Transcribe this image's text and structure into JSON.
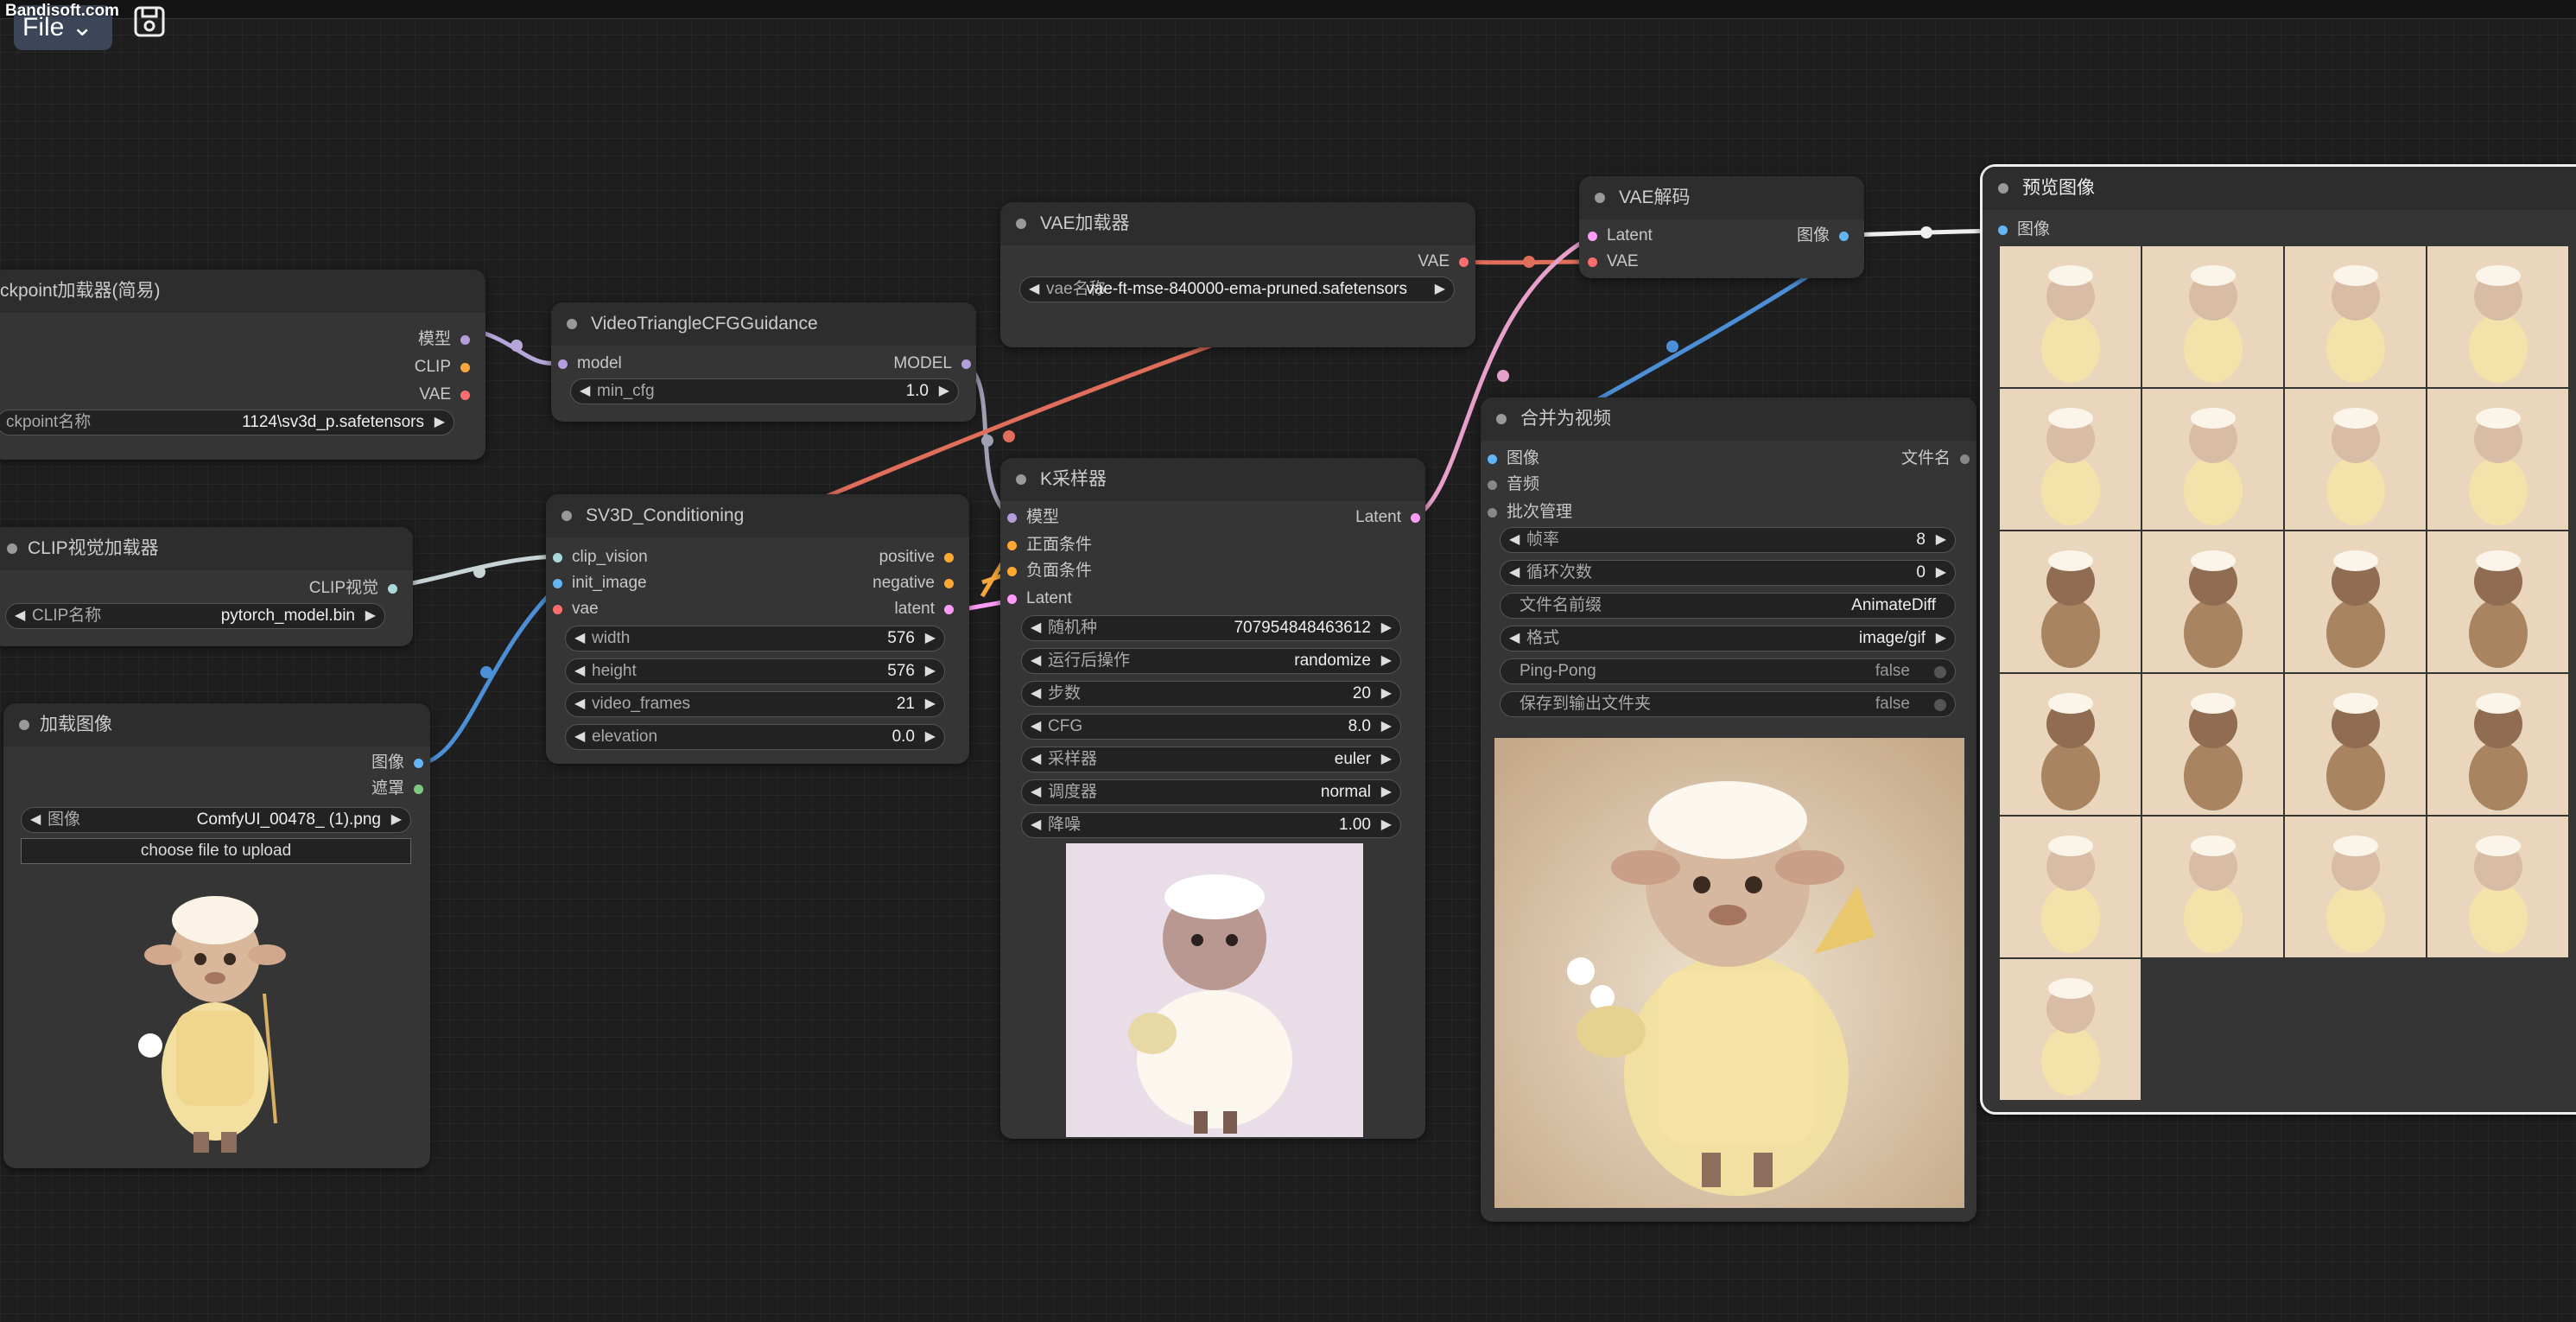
{
  "watermark": "Bandisoft.com",
  "menu": {
    "file": "File"
  },
  "nodes": {
    "checkpoint": {
      "title": "ckpoint加载器(简易)",
      "out_model": "模型",
      "out_clip": "CLIP",
      "out_vae": "VAE",
      "w_label": "ckpoint名称",
      "w_value": "1124\\sv3d_p.safetensors"
    },
    "vtcfg": {
      "title": "VideoTriangleCFGGuidance",
      "in_model": "model",
      "out_model": "MODEL",
      "w_label": "min_cfg",
      "w_value": "1.0"
    },
    "clipvision": {
      "title": "CLIP视觉加载器",
      "out": "CLIP视觉",
      "w_label": "CLIP名称",
      "w_value": "pytorch_model.bin"
    },
    "loadimage": {
      "title": "加载图像",
      "out_image": "图像",
      "out_mask": "遮罩",
      "w_label": "图像",
      "w_value": "ComfyUI_00478_ (1).png",
      "upload": "choose file to upload"
    },
    "sv3d": {
      "title": "SV3D_Conditioning",
      "in_clip": "clip_vision",
      "in_init": "init_image",
      "in_vae": "vae",
      "out_pos": "positive",
      "out_neg": "negative",
      "out_lat": "latent",
      "widgets": [
        {
          "label": "width",
          "value": "576"
        },
        {
          "label": "height",
          "value": "576"
        },
        {
          "label": "video_frames",
          "value": "21"
        },
        {
          "label": "elevation",
          "value": "0.0"
        }
      ]
    },
    "vaeloader": {
      "title": "VAE加载器",
      "out": "VAE",
      "w_label": "vae名称",
      "w_value": "vae-ft-mse-840000-ema-pruned.safetensors"
    },
    "ksampler": {
      "title": "K采样器",
      "in_model": "模型",
      "in_pos": "正面条件",
      "in_neg": "负面条件",
      "in_lat": "Latent",
      "out_lat": "Latent",
      "widgets": [
        {
          "label": "随机种",
          "value": "707954848463612"
        },
        {
          "label": "运行后操作",
          "value": "randomize"
        },
        {
          "label": "步数",
          "value": "20"
        },
        {
          "label": "CFG",
          "value": "8.0"
        },
        {
          "label": "采样器",
          "value": "euler"
        },
        {
          "label": "调度器",
          "value": "normal"
        },
        {
          "label": "降噪",
          "value": "1.00"
        }
      ]
    },
    "vaedecode": {
      "title": "VAE解码",
      "in_lat": "Latent",
      "in_vae": "VAE",
      "out_img": "图像"
    },
    "combine": {
      "title": "合并为视频",
      "in_img": "图像",
      "in_audio": "音频",
      "in_batch": "批次管理",
      "out_fn": "文件名",
      "widgets": [
        {
          "label": "帧率",
          "value": "8"
        },
        {
          "label": "循环次数",
          "value": "0"
        },
        {
          "label": "文件名前缀",
          "value": "AnimateDiff"
        },
        {
          "label": "格式",
          "value": "image/gif"
        }
      ],
      "toggles": [
        {
          "label": "Ping-Pong",
          "value": "false"
        },
        {
          "label": "保存到输出文件夹",
          "value": "false"
        }
      ]
    },
    "preview": {
      "title": "预览图像",
      "in_img": "图像",
      "frame_count": "21"
    }
  },
  "colors": {
    "clip": "#f7a73b",
    "vae": "#ff6e6e",
    "model": "#b39ddb",
    "latent": "#ff9cf9",
    "image": "#64b5f6",
    "conditioning": "#ffa931",
    "clip_vision": "#a8dadc",
    "mask": "#81c784"
  }
}
